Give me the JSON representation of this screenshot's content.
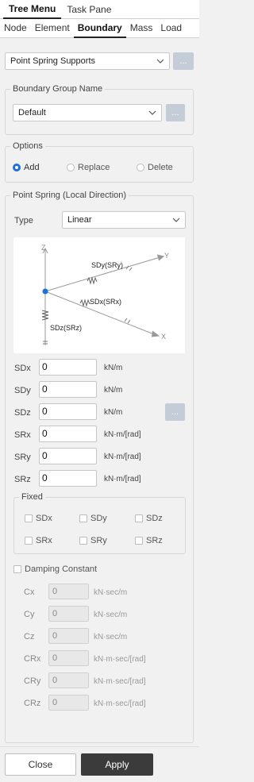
{
  "top_tabs": [
    "Tree Menu",
    "Task Pane"
  ],
  "sub_tabs": [
    "Node",
    "Element",
    "Boundary",
    "Mass",
    "Load"
  ],
  "function_select": "Point Spring Supports",
  "dots": "...",
  "boundary_group": {
    "title": "Boundary Group Name",
    "value": "Default"
  },
  "options": {
    "title": "Options",
    "items": [
      "Add",
      "Replace",
      "Delete"
    ],
    "selected": "Add"
  },
  "point_spring": {
    "title": "Point Spring (Local Direction)",
    "type_label": "Type",
    "type_value": "Linear",
    "diagram": {
      "z": "Z",
      "y": "Y",
      "x": "X",
      "sdy": "SDy(SRy)",
      "sdx": "SDx(SRx)",
      "sdz": "SDz(SRz)"
    },
    "fields": [
      {
        "label": "SDx",
        "value": "0",
        "unit": "kN/m"
      },
      {
        "label": "SDy",
        "value": "0",
        "unit": "kN/m"
      },
      {
        "label": "SDz",
        "value": "0",
        "unit": "kN/m"
      },
      {
        "label": "SRx",
        "value": "0",
        "unit": "kN·m/[rad]"
      },
      {
        "label": "SRy",
        "value": "0",
        "unit": "kN·m/[rad]"
      },
      {
        "label": "SRz",
        "value": "0",
        "unit": "kN·m/[rad]"
      }
    ],
    "fixed": {
      "title": "Fixed",
      "items": [
        "SDx",
        "SDy",
        "SDz",
        "SRx",
        "SRy",
        "SRz"
      ]
    },
    "damping": {
      "label": "Damping Constant",
      "fields": [
        {
          "label": "Cx",
          "value": "0",
          "unit": "kN·sec/m"
        },
        {
          "label": "Cy",
          "value": "0",
          "unit": "kN·sec/m"
        },
        {
          "label": "Cz",
          "value": "0",
          "unit": "kN·sec/m"
        },
        {
          "label": "CRx",
          "value": "0",
          "unit": "kN·m·sec/[rad]"
        },
        {
          "label": "CRy",
          "value": "0",
          "unit": "kN·m·sec/[rad]"
        },
        {
          "label": "CRz",
          "value": "0",
          "unit": "kN·m·sec/[rad]"
        }
      ]
    }
  },
  "buttons": {
    "close": "Close",
    "apply": "Apply"
  },
  "colors": {
    "accent": "#1e6fd9",
    "apply_bg": "#3b3b3b",
    "dots_bg": "#c4ccd8"
  }
}
